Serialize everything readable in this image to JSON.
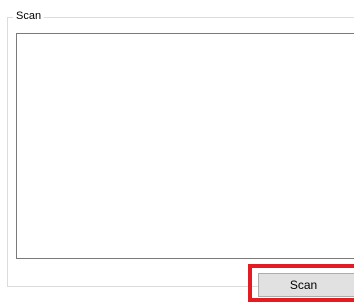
{
  "scan_group": {
    "title": "Scan",
    "output_text": ""
  },
  "scan_button": {
    "label": "Scan"
  },
  "colors": {
    "highlight": "#e31b23",
    "button_face": "#e1e1e1",
    "textbox_border": "#7a7a7a",
    "group_border": "#dcdcdc"
  }
}
